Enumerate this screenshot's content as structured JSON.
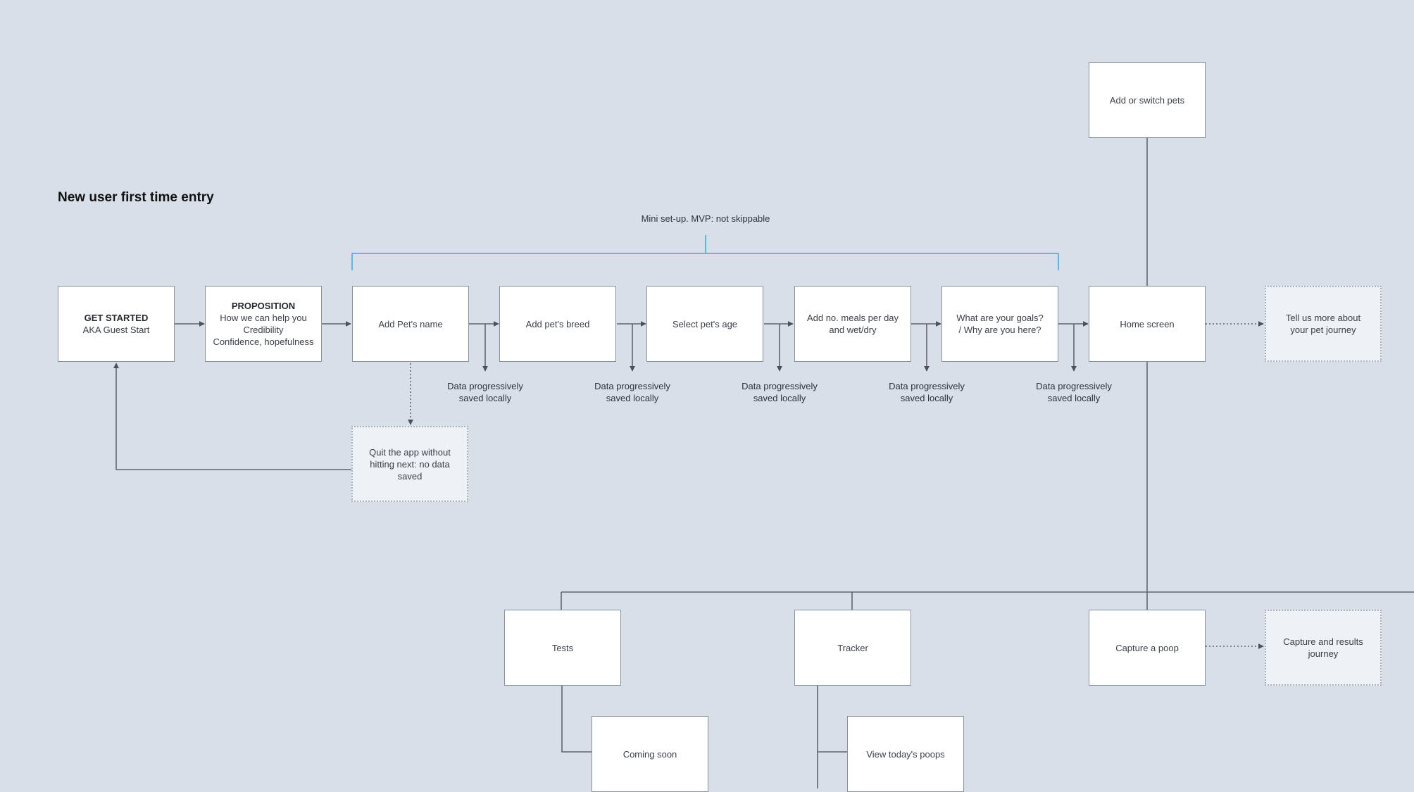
{
  "title": "New user first time entry",
  "bracket_label": "Mini set-up. MVP: not skippable",
  "saved_label": [
    "Data progressively",
    "saved locally"
  ],
  "nodes": {
    "get_started": {
      "heading": "GET STARTED",
      "lines": [
        "AKA Guest Start"
      ]
    },
    "proposition": {
      "heading": "PROPOSITION",
      "lines": [
        "How we can help you",
        "Credibility",
        "Confidence, hopefulness"
      ]
    },
    "add_name": "Add Pet's name",
    "add_breed": "Add pet's breed",
    "select_age": "Select pet's age",
    "meals": "Add no. meals per day and wet/dry",
    "goals": "What are your goals? / Why are you here?",
    "home": "Home screen",
    "tell_us": "Tell us more about your pet journey",
    "add_switch": "Add or switch pets",
    "quit": "Quit the app without hitting next: no data saved",
    "tests": "Tests",
    "coming_soon": "Coming soon",
    "tracker": "Tracker",
    "view_poops": "View today's poops",
    "capture": "Capture a poop",
    "capture_journey": "Capture and results journey"
  },
  "colors": {
    "bracket": "#5bb8ec",
    "line": "#5f6773",
    "background": "#d8dfe8"
  }
}
